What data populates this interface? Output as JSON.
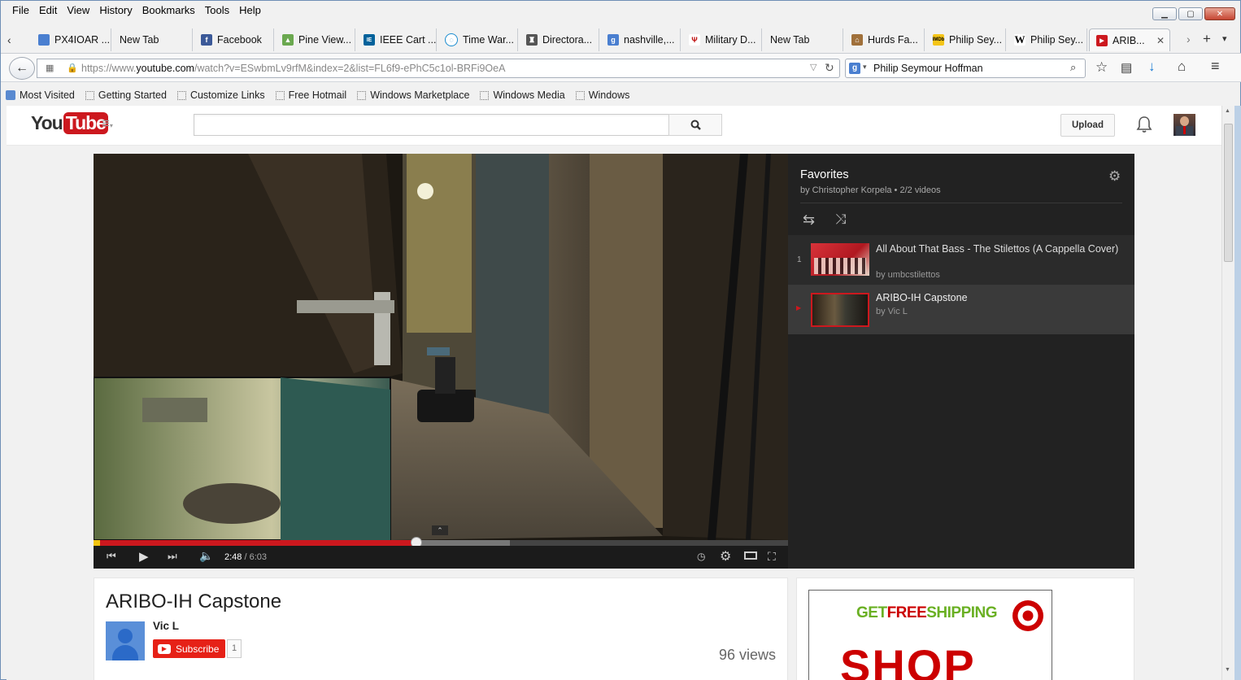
{
  "menu": [
    "File",
    "Edit",
    "View",
    "History",
    "Bookmarks",
    "Tools",
    "Help"
  ],
  "tabs": [
    {
      "label": "PX4IOAR ...",
      "icon": "doc-icon"
    },
    {
      "label": "New Tab",
      "icon": ""
    },
    {
      "label": "Facebook",
      "icon": "facebook-icon"
    },
    {
      "label": "Pine View...",
      "icon": "tree-icon"
    },
    {
      "label": "IEEE Cart ...",
      "icon": "ieee-icon"
    },
    {
      "label": "Time War...",
      "icon": "twc-icon"
    },
    {
      "label": "Directora...",
      "icon": "crest-icon"
    },
    {
      "label": "nashville,...",
      "icon": "google-icon"
    },
    {
      "label": "Military D...",
      "icon": "military-icon"
    },
    {
      "label": "New Tab",
      "icon": ""
    },
    {
      "label": "Hurds Fa...",
      "icon": "farm-icon"
    },
    {
      "label": "Philip Sey...",
      "icon": "imdb-icon"
    },
    {
      "label": "Philip Sey...",
      "icon": "wikipedia-icon"
    },
    {
      "label": "ARIB...",
      "icon": "youtube-icon"
    }
  ],
  "nav": {
    "url_prefix": "https://www.",
    "url_domain": "youtube.com",
    "url_rest": "/watch?v=ESwbmLv9rfM&index=2&list=FL6f9-ePhC5c1ol-BRFi9OeA",
    "search_value": "Philip Seymour Hoffman"
  },
  "bookmarks": [
    "Most Visited",
    "Getting Started",
    "Customize Links",
    "Free Hotmail",
    "Windows Marketplace",
    "Windows Media",
    "Windows"
  ],
  "yt": {
    "logo_you": "You",
    "logo_tube": "Tube",
    "search_placeholder": "",
    "upload_label": "Upload"
  },
  "player": {
    "time_current": "2:48",
    "time_total": "/ 6:03",
    "progress_fraction": 0.465,
    "buffered_fraction": 0.6
  },
  "playlist": {
    "title": "Favorites",
    "meta": "by Christopher Korpela • 2/2 videos",
    "items": [
      {
        "index": "1",
        "title": "All About That Bass - The Stilettos (A Cappella Cover)",
        "by": "by umbcstilettos"
      },
      {
        "index": "▶",
        "title": "ARIBO-IH Capstone",
        "by": "by Vic L"
      }
    ]
  },
  "video_info": {
    "title": "ARIBO-IH Capstone",
    "channel": "Vic L",
    "subscribe_label": "Subscribe",
    "subscriber_count": "1",
    "views": "96 views"
  },
  "ad": {
    "get": "GET",
    "free": "FREE",
    "shipping": "SHIPPING",
    "shop": "SHOP"
  },
  "colors": {
    "yt_red": "#cc181e",
    "target_red": "#cc0000",
    "ad_green": "#6ab023"
  }
}
